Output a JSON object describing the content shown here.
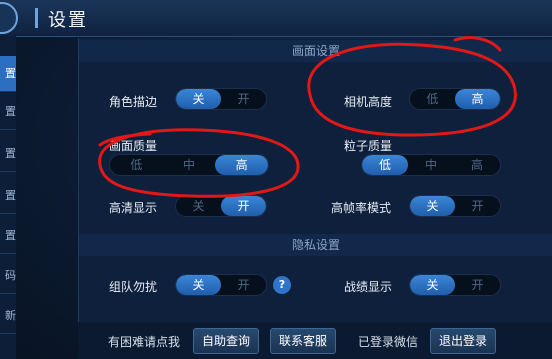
{
  "header": {
    "title": "设置"
  },
  "sidebar": {
    "tabs": [
      "置",
      "置",
      "置",
      "置",
      "置",
      "码",
      "新"
    ]
  },
  "sections": {
    "display": "画面设置",
    "privacy": "隐私设置"
  },
  "settings": {
    "outline": {
      "label": "角色描边",
      "options": [
        "关",
        "开"
      ],
      "selected": "关"
    },
    "camera": {
      "label": "相机高度",
      "options": [
        "低",
        "高"
      ],
      "selected": "高"
    },
    "quality": {
      "label": "画面质量",
      "options": [
        "低",
        "中",
        "高"
      ],
      "selected": "高"
    },
    "particle": {
      "label": "粒子质量",
      "options": [
        "低",
        "中",
        "高"
      ],
      "selected": "低"
    },
    "hd": {
      "label": "高清显示",
      "options": [
        "关",
        "开"
      ],
      "selected": "开"
    },
    "highfps": {
      "label": "高帧率模式",
      "options": [
        "关",
        "开"
      ],
      "selected": "关"
    },
    "team": {
      "label": "组队勿扰",
      "options": [
        "关",
        "开"
      ],
      "selected": "关"
    },
    "record": {
      "label": "战绩显示",
      "options": [
        "关",
        "开"
      ],
      "selected": "关"
    }
  },
  "help": {
    "glyph": "?"
  },
  "footer": {
    "prompt": "有困难请点我",
    "self_help": "自助查询",
    "contact": "联系客服",
    "wechat_status": "已登录微信",
    "logout": "退出登录"
  },
  "colors": {
    "accent": "#2f74c8",
    "annotation": "#e01818"
  }
}
